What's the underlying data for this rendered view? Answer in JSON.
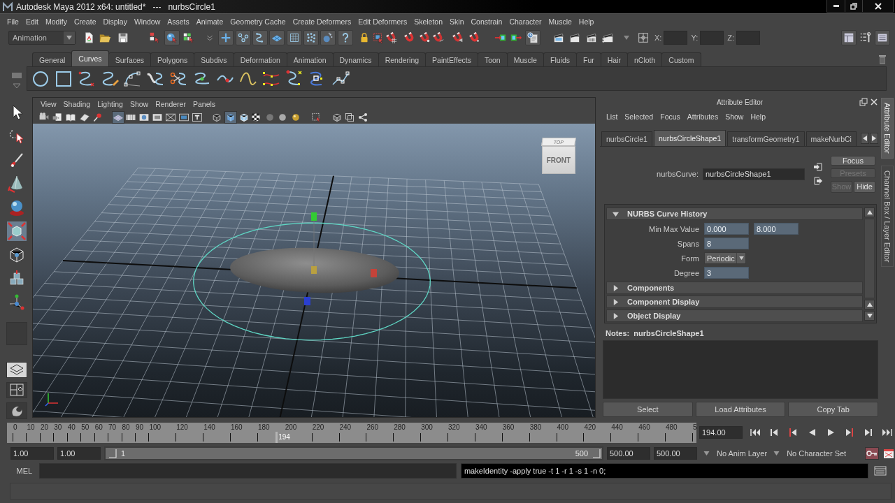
{
  "window": {
    "title": "Autodesk Maya 2012 x64: untitled*   ---   nurbsCircle1"
  },
  "menu_bar": [
    "File",
    "Edit",
    "Modify",
    "Create",
    "Display",
    "Window",
    "Assets",
    "Animate",
    "Geometry Cache",
    "Create Deformers",
    "Edit Deformers",
    "Skeleton",
    "Skin",
    "Constrain",
    "Character",
    "Muscle",
    "Help"
  ],
  "status_line": {
    "mode": "Animation",
    "coordinate_fields": [
      {
        "label": "X:"
      },
      {
        "label": "Y:"
      },
      {
        "label": "Z:"
      }
    ]
  },
  "shelf": {
    "tabs": [
      {
        "label": "General",
        "selected": false
      },
      {
        "label": "Curves",
        "selected": true
      },
      {
        "label": "Surfaces",
        "selected": false
      },
      {
        "label": "Polygons",
        "selected": false
      },
      {
        "label": "Subdivs",
        "selected": false
      },
      {
        "label": "Deformation",
        "selected": false
      },
      {
        "label": "Animation",
        "selected": false
      },
      {
        "label": "Dynamics",
        "selected": false
      },
      {
        "label": "Rendering",
        "selected": false
      },
      {
        "label": "PaintEffects",
        "selected": false
      },
      {
        "label": "Toon",
        "selected": false
      },
      {
        "label": "Muscle",
        "selected": false
      },
      {
        "label": "Fluids",
        "selected": false
      },
      {
        "label": "Fur",
        "selected": false
      },
      {
        "label": "Hair",
        "selected": false
      },
      {
        "label": "nCloth",
        "selected": false
      },
      {
        "label": "Custom",
        "selected": false
      }
    ]
  },
  "viewport": {
    "menu": [
      "View",
      "Shading",
      "Lighting",
      "Show",
      "Renderer",
      "Panels"
    ],
    "view_cube": {
      "top": "TOP",
      "front": "FRONT"
    }
  },
  "attribute_editor": {
    "title": "Attribute Editor",
    "menu": [
      "List",
      "Selected",
      "Focus",
      "Attributes",
      "Show",
      "Help"
    ],
    "tabs": [
      {
        "label": "nurbsCircle1",
        "selected": false
      },
      {
        "label": "nurbsCircleShape1",
        "selected": true
      },
      {
        "label": "transformGeometry1",
        "selected": false
      },
      {
        "label": "makeNurbCi",
        "selected": false
      }
    ],
    "node_field": {
      "label": "nurbsCurve:",
      "value": "nurbsCircleShape1"
    },
    "buttons": [
      {
        "label": "Focus",
        "disabled": false
      },
      {
        "label": "Presets",
        "disabled": true
      },
      {
        "label": "Show",
        "disabled": true
      },
      {
        "label": "Hide",
        "disabled": false
      }
    ],
    "sections": [
      {
        "title": "NURBS Curve History",
        "expanded": true,
        "rows": [
          {
            "kind": "pair",
            "label": "Min Max Value",
            "values": [
              "0.000",
              "8.000"
            ]
          },
          {
            "kind": "number",
            "label": "Spans",
            "value": "8"
          },
          {
            "kind": "dropdown",
            "label": "Form",
            "value": "Periodic"
          },
          {
            "kind": "number",
            "label": "Degree",
            "value": "3"
          }
        ]
      },
      {
        "title": "Components",
        "expanded": false
      },
      {
        "title": "Component Display",
        "expanded": false
      },
      {
        "title": "Object Display",
        "expanded": false
      }
    ],
    "notes_title": "Notes:  nurbsCircleShape1",
    "footer_buttons": [
      "Select",
      "Load Attributes",
      "Copy Tab"
    ],
    "side_tabs": [
      {
        "label": "Attribute Editor",
        "selected": true
      },
      {
        "label": "Channel Box / Layer Editor",
        "selected": false
      }
    ]
  },
  "time_slider": {
    "ticks": [
      "0",
      "10",
      "20",
      "30",
      "40",
      "50",
      "60",
      "70",
      "80",
      "90",
      "100",
      "120",
      "140",
      "160",
      "180",
      "200",
      "220",
      "240",
      "260",
      "280",
      "300",
      "320",
      "340",
      "360",
      "380",
      "400",
      "420",
      "440",
      "460",
      "480",
      "5"
    ],
    "current_frame": "194",
    "level": 0.388,
    "frame_field": "194.00"
  },
  "range_slider": {
    "start": "1.00",
    "playback_start": "1.00",
    "range_start": "1",
    "range_end": "500",
    "level": 1,
    "playback_end": "500.00",
    "end": "500.00",
    "anim_layer": "No Anim Layer",
    "character_set": "No Character Set"
  },
  "command_line": {
    "language": "MEL",
    "result": "makeIdentity -apply true -t 1 -r 1 -s 1 -n 0;"
  }
}
